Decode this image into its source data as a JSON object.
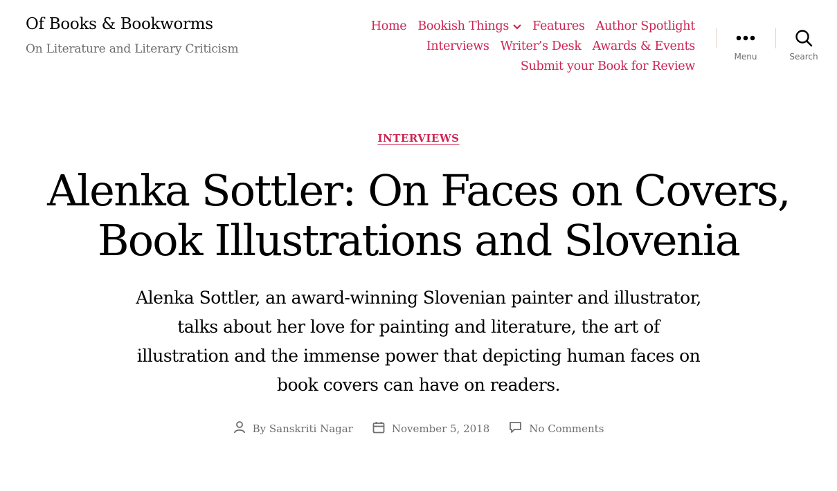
{
  "site": {
    "title": "Of Books & Bookworms",
    "description": "On Literature and Literary Criticism"
  },
  "nav": {
    "items": [
      "Home",
      "Bookish Things",
      "Features",
      "Author Spotlight",
      "Interviews",
      "Writer’s Desk",
      "Awards & Events",
      "Submit your Book for Review"
    ],
    "menu_label": "Menu",
    "search_label": "Search"
  },
  "post": {
    "category": "INTERVIEWS",
    "title": "Alenka Sottler: On Faces on Covers, Book Illustrations and Slovenia",
    "excerpt": "Alenka Sottler, an award-winning Slovenian painter and illustrator, talks about her love for painting and literature, the art of illustration and the immense power that depicting human faces on book covers can have on readers.",
    "meta": {
      "author_prefix": "By",
      "author": "Sanskriti Nagar",
      "date": "November 5, 2018",
      "comments": "No Comments"
    }
  },
  "colors": {
    "accent": "#cd2653",
    "secondary_text": "#6d6d6d",
    "divider": "#dcd7ca"
  },
  "icons": [
    "chevron-down-icon",
    "ellipsis-icon",
    "search-icon",
    "user-icon",
    "calendar-icon",
    "comment-icon"
  ]
}
